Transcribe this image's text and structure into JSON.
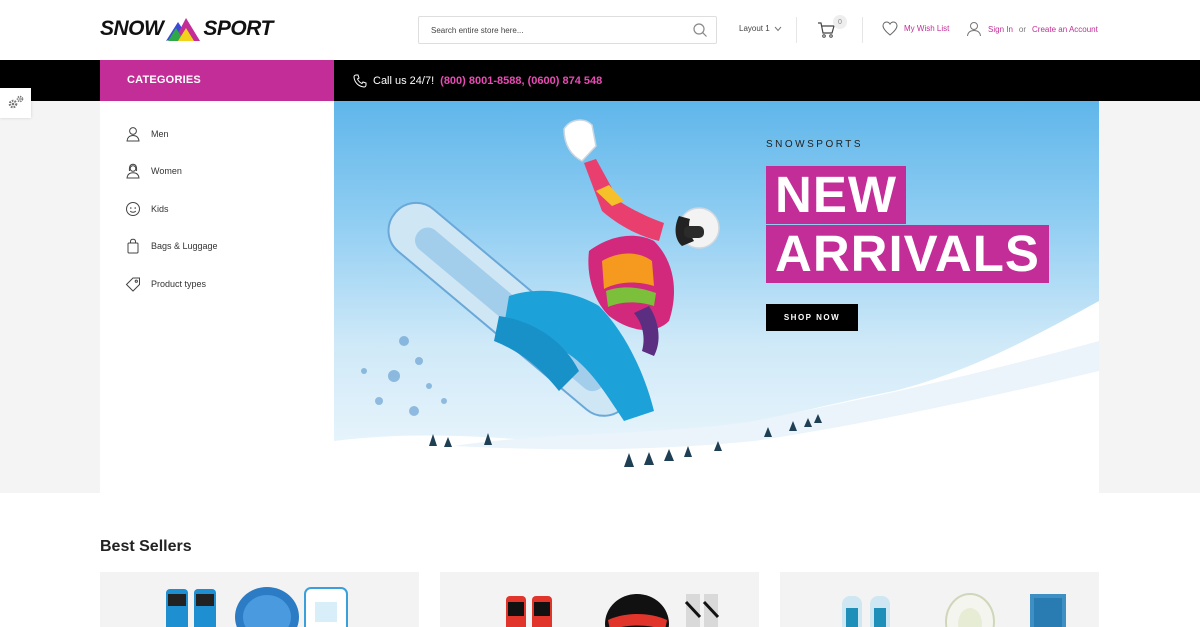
{
  "header": {
    "logo_left": "SNOW",
    "logo_right": "SPORT",
    "search_placeholder": "Search entire store here...",
    "layout_label": "Layout 1",
    "cart_count": "0",
    "wishlist_label": "My Wish List",
    "sign_in_label": "Sign In",
    "or_label": "or",
    "create_account_label": "Create an Account"
  },
  "nav": {
    "categories_label": "CATEGORIES",
    "call_label": "Call us 24/7!",
    "phones": "(800) 8001-8588, (0600) 874 548"
  },
  "sidebar": {
    "items": [
      {
        "label": "Men",
        "icon": "man-icon"
      },
      {
        "label": "Women",
        "icon": "woman-icon"
      },
      {
        "label": "Kids",
        "icon": "kids-icon"
      },
      {
        "label": "Bags & Luggage",
        "icon": "bag-icon"
      },
      {
        "label": "Product types",
        "icon": "tag-icon"
      }
    ]
  },
  "hero": {
    "kicker": "SNOWSPORTS",
    "line1": "NEW",
    "line2": "ARRIVALS",
    "button_label": "SHOP NOW"
  },
  "best_sellers": {
    "title": "Best Sellers"
  },
  "colors": {
    "accent": "#c22d97",
    "navbar": "#000000",
    "background_band": "#f4f4f4"
  }
}
